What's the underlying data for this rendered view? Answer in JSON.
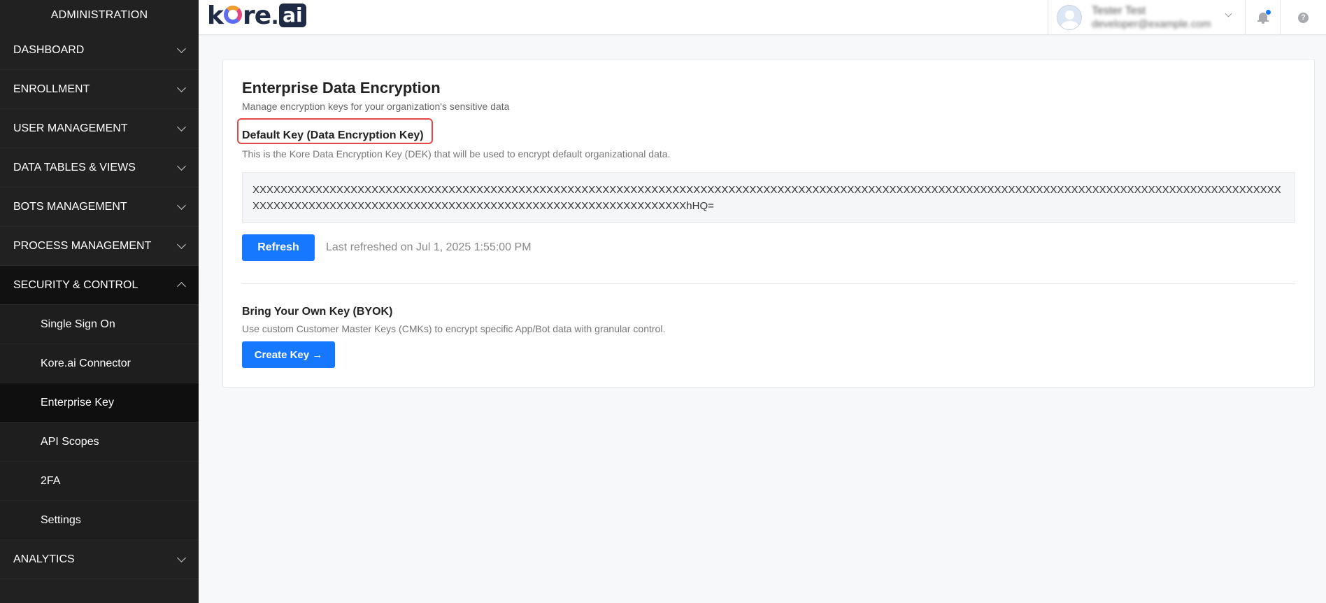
{
  "sidebar": {
    "title": "ADMINISTRATION",
    "items": [
      {
        "label": "DASHBOARD"
      },
      {
        "label": "ENROLLMENT"
      },
      {
        "label": "USER MANAGEMENT"
      },
      {
        "label": "DATA TABLES & VIEWS"
      },
      {
        "label": "BOTS MANAGEMENT"
      },
      {
        "label": "PROCESS MANAGEMENT"
      },
      {
        "label": "SECURITY & CONTROL"
      }
    ],
    "sub_items": [
      {
        "label": "Single Sign On"
      },
      {
        "label": "Kore.ai Connector"
      },
      {
        "label": "Enterprise Key"
      },
      {
        "label": "API Scopes"
      },
      {
        "label": "2FA"
      },
      {
        "label": "Settings"
      }
    ],
    "bottom_items": [
      {
        "label": "ANALYTICS"
      }
    ]
  },
  "header": {
    "logo_text": "kore",
    "logo_badge": "ai",
    "user_name": "Tester Test",
    "user_email": "developer@example.com",
    "icons": [
      "bell-icon",
      "help-icon"
    ],
    "notification_color": "#1677ff"
  },
  "main": {
    "title": "Enterprise Data Encryption",
    "subtitle": "Manage encryption keys for your organization's sensitive data",
    "default_key": {
      "title": "Default Key (Data Encryption Key)",
      "description": "This is the Kore Data Encryption Key (DEK) that will be used to encrypt default organizational data.",
      "value": "XXXXXXXXXXXXXXXXXXXXXXXXXXXXXXXXXXXXXXXXXXXXXXXXXXXXXXXXXXXXXXXXXXXXXXXXXXXXXXXXXXXXXXXXXXXXXXXXXXXXXXXXXXXXXXXXXXXXXXXXXXXXXXXXXXXXXXXXXXXXXXXXXXXXXXXXXXXXXXXXXXXXXXXXXXXXXXXXXXXXXXXXXXXXXXXXXXXXXXXXXXXXXXXXXhHQ=",
      "refresh_label": "Refresh",
      "last_refreshed": "Last refreshed on Jul 1, 2025 1:55:00 PM"
    },
    "byok": {
      "title": "Bring Your Own Key (BYOK)",
      "description": "Use custom Customer Master Keys (CMKs) to encrypt specific App/Bot data with granular control.",
      "create_label": "Create Key →"
    }
  },
  "colors": {
    "accent": "#1677ff",
    "sidebar_bg": "#212121",
    "highlight": "#e54848"
  }
}
